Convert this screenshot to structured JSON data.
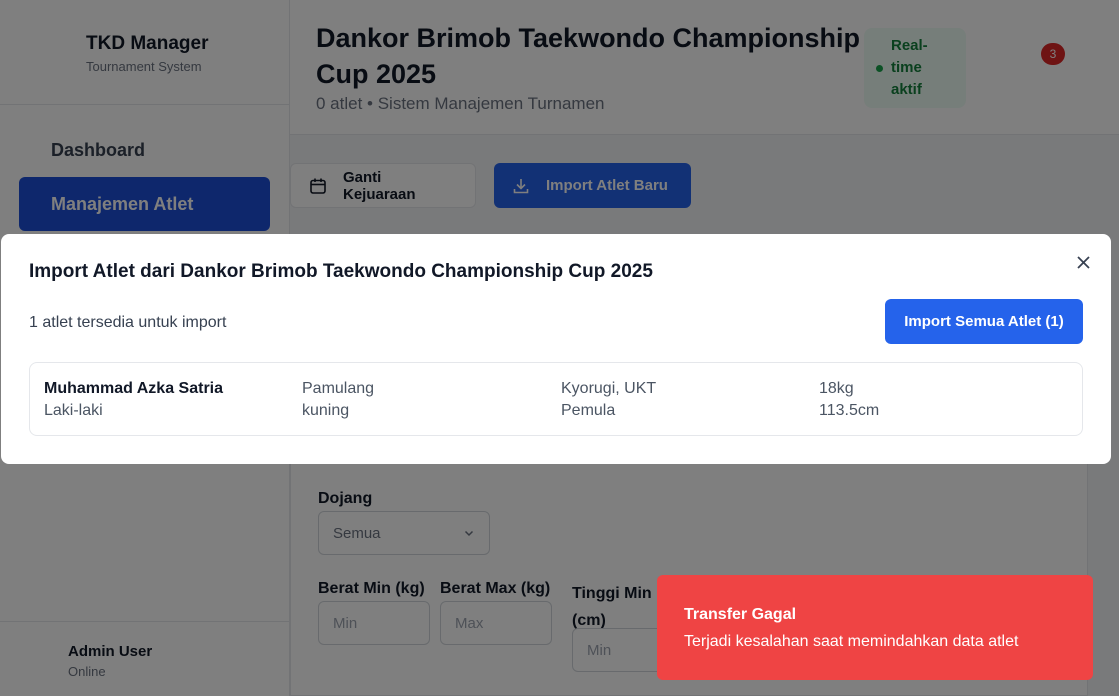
{
  "sidebar": {
    "app_title": "TKD Manager",
    "app_subtitle": "Tournament System",
    "items": [
      {
        "label": "Dashboard"
      },
      {
        "label": "Manajemen Atlet"
      }
    ],
    "user": {
      "name": "Admin User",
      "status": "Online"
    }
  },
  "header": {
    "title": "Dankor Brimob Taekwondo Championship Cup 2025",
    "subtitle": "0 atlet • Sistem Manajemen Turnamen",
    "realtime_label": "Real-time aktif",
    "notification_count": "3"
  },
  "toolbar": {
    "change_label": "Ganti Kejuaraan",
    "import_label": "Import Atlet Baru"
  },
  "filters": {
    "dojang_label": "Dojang",
    "dojang_value": "Semua",
    "weight_min_label": "Berat Min (kg)",
    "weight_min_placeholder": "Min",
    "weight_max_label": "Berat Max (kg)",
    "weight_max_placeholder": "Max",
    "height_min_label": "Tinggi Min (cm)",
    "height_min_placeholder": "Min"
  },
  "modal": {
    "title": "Import Atlet dari Dankor Brimob Taekwondo Championship Cup 2025",
    "available_text": "1 atlet tersedia untuk import",
    "import_all_label": "Import Semua Atlet (1)",
    "athletes": [
      {
        "name": "Muhammad Azka Satria",
        "gender": "Laki-laki",
        "dojang": "Pamulang",
        "belt": "kuning",
        "category": "Kyorugi, UKT",
        "level": "Pemula",
        "weight": "18kg",
        "height": "113.5cm"
      }
    ]
  },
  "toast": {
    "title": "Transfer Gagal",
    "message": "Terjadi kesalahan saat memindahkan data atlet"
  },
  "colors": {
    "primary": "#2563eb",
    "nav_active": "#1d4ed8",
    "toast_error": "#ef4444",
    "status_green": "#16a34a"
  }
}
